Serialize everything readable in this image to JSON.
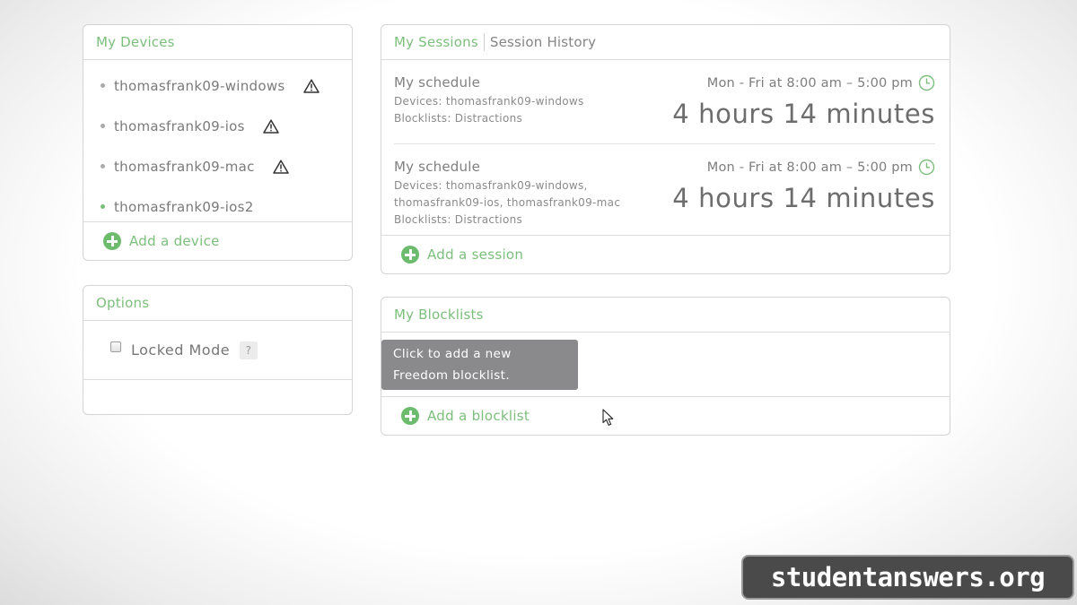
{
  "devices": {
    "title": "My Devices",
    "items": [
      {
        "name": "thomasfrank09-windows",
        "status": "warning"
      },
      {
        "name": "thomasfrank09-ios",
        "status": "warning"
      },
      {
        "name": "thomasfrank09-mac",
        "status": "warning"
      },
      {
        "name": "thomasfrank09-ios2",
        "status": "online"
      }
    ],
    "add_label": "Add a device"
  },
  "options": {
    "title": "Options",
    "locked_mode_label": "Locked Mode",
    "locked_mode_checked": false,
    "help_label": "?"
  },
  "sessions": {
    "tab_active": "My Sessions",
    "tab_inactive": "Session History",
    "items": [
      {
        "name": "My schedule",
        "devices_line1": "Devices: thomasfrank09-windows",
        "devices_line2": "",
        "blocklists": "Blocklists: Distractions",
        "schedule": "Mon - Fri at 8:00 am – 5:00 pm",
        "duration": "4 hours 14 minutes"
      },
      {
        "name": "My schedule",
        "devices_line1": "Devices: thomasfrank09-windows,",
        "devices_line2": "thomasfrank09-ios, thomasfrank09-mac",
        "blocklists": "Blocklists: Distractions",
        "schedule": "Mon - Fri at 8:00 am – 5:00 pm",
        "duration": "4 hours 14 minutes"
      }
    ],
    "add_label": "Add a session"
  },
  "blocklists": {
    "title": "My Blocklists",
    "tooltip_line1": "Click to add a new",
    "tooltip_line2": "Freedom blocklist.",
    "add_label": "Add a blocklist"
  },
  "watermark": {
    "text": "studentanswers.org"
  },
  "colors": {
    "accent": "#7cbf7c",
    "plus": "#6dbb6d",
    "tooltip": "#8a8a8c"
  }
}
